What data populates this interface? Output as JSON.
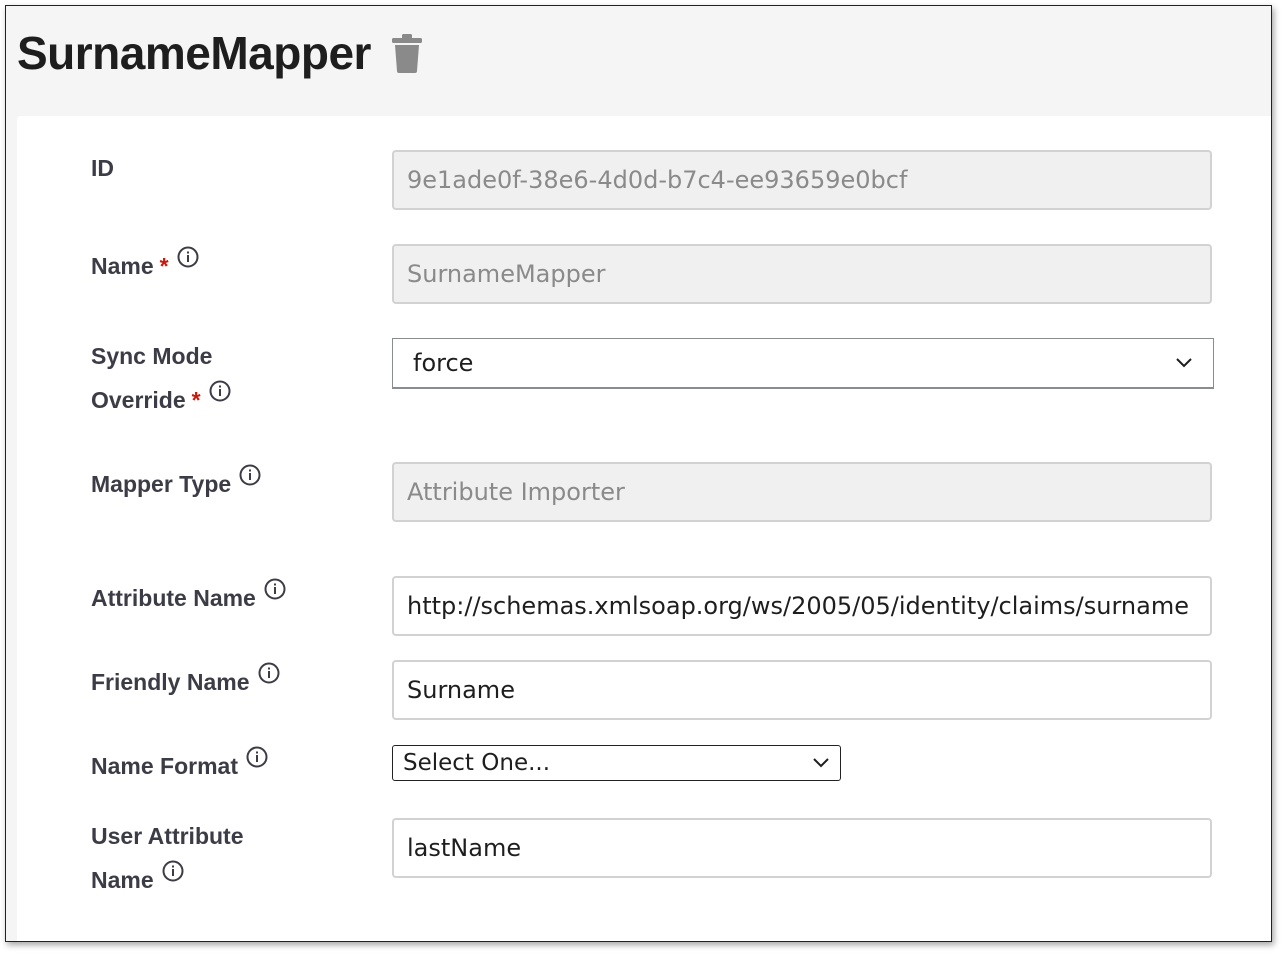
{
  "header": {
    "title": "SurnameMapper"
  },
  "form": {
    "id": {
      "label": "ID",
      "value": "9e1ade0f-38e6-4d0d-b7c4-ee93659e0bcf"
    },
    "name": {
      "label": "Name",
      "required_mark": "*",
      "value": "SurnameMapper"
    },
    "sync_mode": {
      "label_line1": "Sync Mode",
      "label_line2": "Override",
      "required_mark": "*",
      "value": "force"
    },
    "mapper_type": {
      "label": "Mapper Type",
      "value": "Attribute Importer"
    },
    "attribute_name": {
      "label": "Attribute Name",
      "value": "http://schemas.xmlsoap.org/ws/2005/05/identity/claims/surname"
    },
    "friendly_name": {
      "label": "Friendly Name",
      "value": "Surname"
    },
    "name_format": {
      "label": "Name Format",
      "value": "Select One..."
    },
    "user_attribute_name": {
      "label_line1": "User Attribute",
      "label_line2": "Name",
      "value": "lastName"
    }
  },
  "colors": {
    "required": "#c9190b",
    "label_text": "#3c3c46",
    "readonly_bg": "#f0f0f0"
  },
  "icons": {
    "delete": "trash-icon",
    "help": "info-circle-icon",
    "dropdown": "chevron-down-icon"
  }
}
